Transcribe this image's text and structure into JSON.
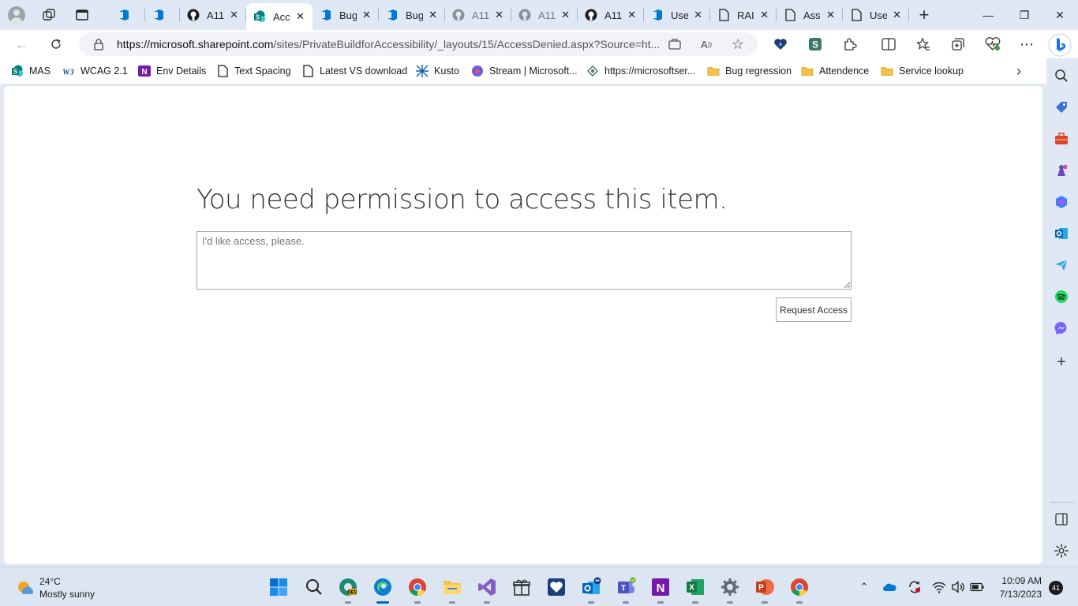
{
  "browser": {
    "tabs": [
      {
        "title": "",
        "icon": "azure-devops-icon"
      },
      {
        "title": "",
        "icon": "azure-devops-icon"
      },
      {
        "title": "A11",
        "icon": "github-icon"
      },
      {
        "title": "Acc",
        "icon": "sharepoint-icon",
        "active": true
      },
      {
        "title": "Bug",
        "icon": "azure-devops-icon"
      },
      {
        "title": "Bug",
        "icon": "azure-devops-icon"
      },
      {
        "title": "A11",
        "icon": "github-icon"
      },
      {
        "title": "A11",
        "icon": "github-icon"
      },
      {
        "title": "A11",
        "icon": "github-icon"
      },
      {
        "title": "Use",
        "icon": "azure-devops-icon"
      },
      {
        "title": "RAI",
        "icon": "page-icon"
      },
      {
        "title": "Ass",
        "icon": "page-icon"
      },
      {
        "title": "Use",
        "icon": "page-icon"
      }
    ],
    "address": {
      "host": "https://microsoft.sharepoint.com",
      "path": "/sites/PrivateBuildforAccessibility/_layouts/15/AccessDenied.aspx?Source=ht..."
    },
    "favorites": [
      {
        "label": "MAS",
        "icon": "sharepoint-icon"
      },
      {
        "label": "WCAG 2.1",
        "icon": "w3c-icon"
      },
      {
        "label": "Env Details",
        "icon": "onenote-icon"
      },
      {
        "label": "Text Spacing",
        "icon": "page-icon"
      },
      {
        "label": "Latest VS download",
        "icon": "page-icon"
      },
      {
        "label": "Kusto",
        "icon": "kusto-icon"
      },
      {
        "label": "Stream | Microsoft...",
        "icon": "stream-icon"
      },
      {
        "label": "https://microsoftser...",
        "icon": "service-icon"
      },
      {
        "label": "Bug regression",
        "icon": "folder-icon"
      },
      {
        "label": "Attendence",
        "icon": "folder-icon"
      },
      {
        "label": "Service lookup",
        "icon": "folder-icon"
      }
    ]
  },
  "page": {
    "heading": "You need permission to access this item.",
    "message_placeholder": "I'd like access, please.",
    "request_button": "Request Access"
  },
  "taskbar": {
    "weather_temp": "24°C",
    "weather_desc": "Mostly sunny",
    "time": "10:09 AM",
    "date": "7/13/2023",
    "notifications": "41"
  },
  "colors": {
    "accent": "#0067c0",
    "chrome_bg": "#dfe8f4",
    "github": "#1b1f23",
    "azure": "#0078d4",
    "sharepoint": "#038387",
    "folder": "#f5c243"
  }
}
